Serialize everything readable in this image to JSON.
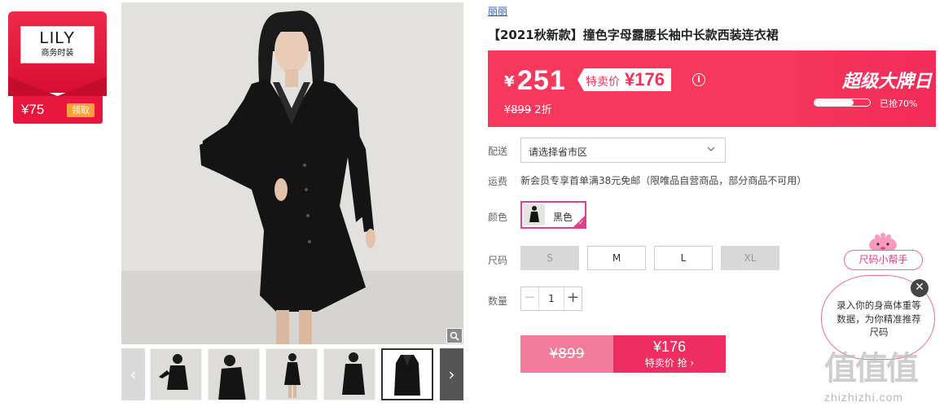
{
  "coupon": {
    "brand": "LILY",
    "brand_sub": "商务时装",
    "amount": "¥75",
    "claim_label": "领取"
  },
  "gallery": {
    "thumb_left_arrow": "‹",
    "thumb_right_arrow": "›"
  },
  "product": {
    "brand_link": "丽丽",
    "title": "【2021秋新款】撞色字母露腰长袖中长款西装连衣裙"
  },
  "price_band": {
    "yen": "¥",
    "price": "251",
    "special_label": "特卖价",
    "special_price": "¥176",
    "info_icon": "i",
    "original_price": "¥899",
    "discount": "2折",
    "promo_title": "超级大牌日",
    "sold_fraction": 0.7,
    "sold_text": "已抢70%"
  },
  "options": {
    "delivery_label": "配送",
    "delivery_placeholder": "请选择省市区",
    "shipping_label": "运费",
    "shipping_text": "新会员专享首单满38元免邮（限唯品自营商品，部分商品不可用）",
    "color_label": "颜色",
    "color_value": "黑色",
    "size_label": "尺码",
    "sizes": [
      {
        "label": "S",
        "available": false
      },
      {
        "label": "M",
        "available": true
      },
      {
        "label": "L",
        "available": true
      },
      {
        "label": "XL",
        "available": false
      }
    ],
    "quantity_label": "数量",
    "quantity_value": "1",
    "minus": "−",
    "plus": "+"
  },
  "buy_button": {
    "original_price": "¥899",
    "special_price": "¥176",
    "action": "特卖价 抢 ›"
  },
  "size_helper": {
    "title": "尺码小帮手",
    "message": "录入你的身高体重等数据，为你精准推荐尺码",
    "close": "✕"
  },
  "watermark": {
    "logo": "值值值",
    "url": "zhizhizhi.com"
  },
  "colors": {
    "promo_pink": "#f5385c",
    "accent_magenta": "#e0408a",
    "coupon_red": "#e8153d"
  }
}
